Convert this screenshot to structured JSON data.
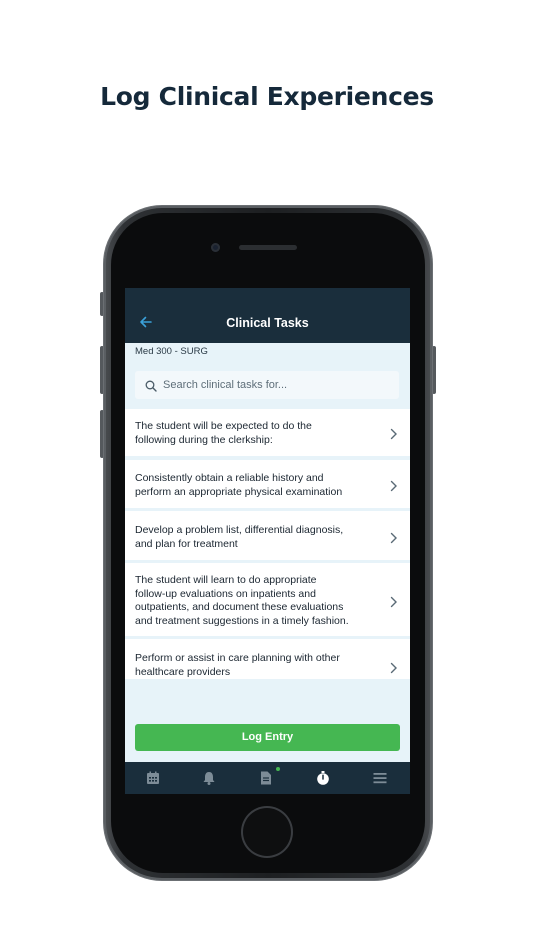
{
  "headline": "Log Clinical Experiences",
  "navbar": {
    "title": "Clinical Tasks",
    "back_icon": "arrow-left-icon"
  },
  "course_label": "Med 300 - SURG",
  "search": {
    "placeholder": "Search clinical tasks for...",
    "icon": "search-icon"
  },
  "tasks": [
    {
      "lines": [
        "The student will be expected to do the",
        "following during the clerkship:"
      ]
    },
    {
      "lines": [
        "Consistently obtain a reliable history and",
        "perform an appropriate physical examination"
      ]
    },
    {
      "lines": [
        "Develop a problem list, differential diagnosis,",
        "and plan for treatment"
      ]
    },
    {
      "lines": [
        "The student will learn to do appropriate",
        "follow-up evaluations on inpatients and",
        "outpatients, and document these evaluations",
        "and treatment suggestions in a timely fashion."
      ]
    },
    {
      "lines": [
        "Perform or assist in care planning with other",
        "healthcare providers"
      ]
    }
  ],
  "log_button": "Log Entry",
  "tabbar": {
    "tabs": [
      "calendar-icon",
      "bell-icon",
      "document-icon",
      "stopwatch-icon",
      "menu-icon"
    ],
    "active": "stopwatch-icon",
    "badge_tab": "document-icon"
  },
  "colors": {
    "navbar": "#1a2e3c",
    "accent_green": "#45b752",
    "back_arrow": "#3aa0d8",
    "screen_bg": "#e7f3f9"
  }
}
